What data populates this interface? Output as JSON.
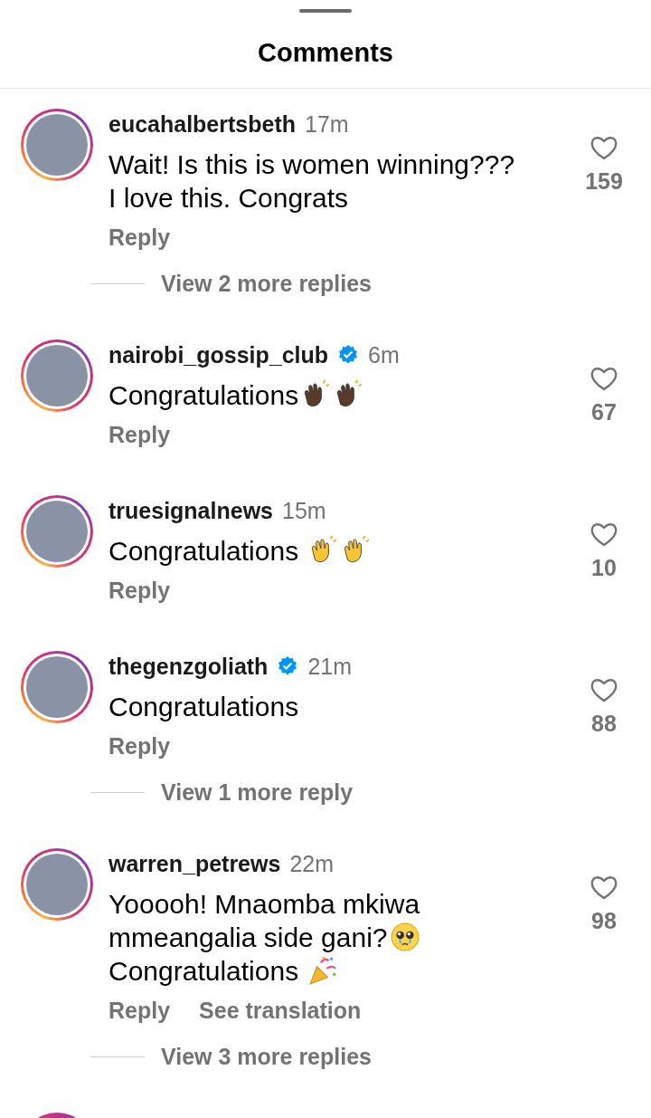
{
  "title": "Comments",
  "comments": [
    {
      "username": "eucahalbertsbeth",
      "verified": false,
      "time": "17m",
      "segments": [
        {
          "kind": "text",
          "text": "Wait! Is this is women winning???"
        },
        {
          "kind": "break"
        },
        {
          "kind": "text",
          "text": "I love this. Congrats"
        }
      ],
      "likes": "159",
      "actions": [
        "Reply"
      ],
      "view_replies": "View 2 more replies"
    },
    {
      "username": "nairobi_gossip_club",
      "verified": true,
      "time": "6m",
      "segments": [
        {
          "kind": "text",
          "text": "Congratulations"
        },
        {
          "kind": "clap-dark"
        },
        {
          "kind": "clap-dark"
        }
      ],
      "likes": "67",
      "actions": [
        "Reply"
      ]
    },
    {
      "username": "truesignalnews",
      "verified": false,
      "time": "15m",
      "segments": [
        {
          "kind": "text",
          "text": "Congratulations "
        },
        {
          "kind": "clap"
        },
        {
          "kind": "clap"
        }
      ],
      "likes": "10",
      "actions": [
        "Reply"
      ]
    },
    {
      "username": "thegenzgoliath",
      "verified": true,
      "time": "21m",
      "segments": [
        {
          "kind": "text",
          "text": "Congratulations"
        }
      ],
      "likes": "88",
      "actions": [
        "Reply"
      ],
      "view_replies": "View 1 more reply"
    },
    {
      "username": "warren_petrews",
      "verified": false,
      "time": "22m",
      "segments": [
        {
          "kind": "text",
          "text": "Yooooh! Mnaomba mkiwa"
        },
        {
          "kind": "break"
        },
        {
          "kind": "text",
          "text": "mmeangalia side gani?"
        },
        {
          "kind": "pleading"
        },
        {
          "kind": "break"
        },
        {
          "kind": "text",
          "text": "Congratulations "
        },
        {
          "kind": "party"
        }
      ],
      "likes": "98",
      "actions": [
        "Reply",
        "See translation"
      ],
      "view_replies": "View 3 more replies"
    }
  ]
}
